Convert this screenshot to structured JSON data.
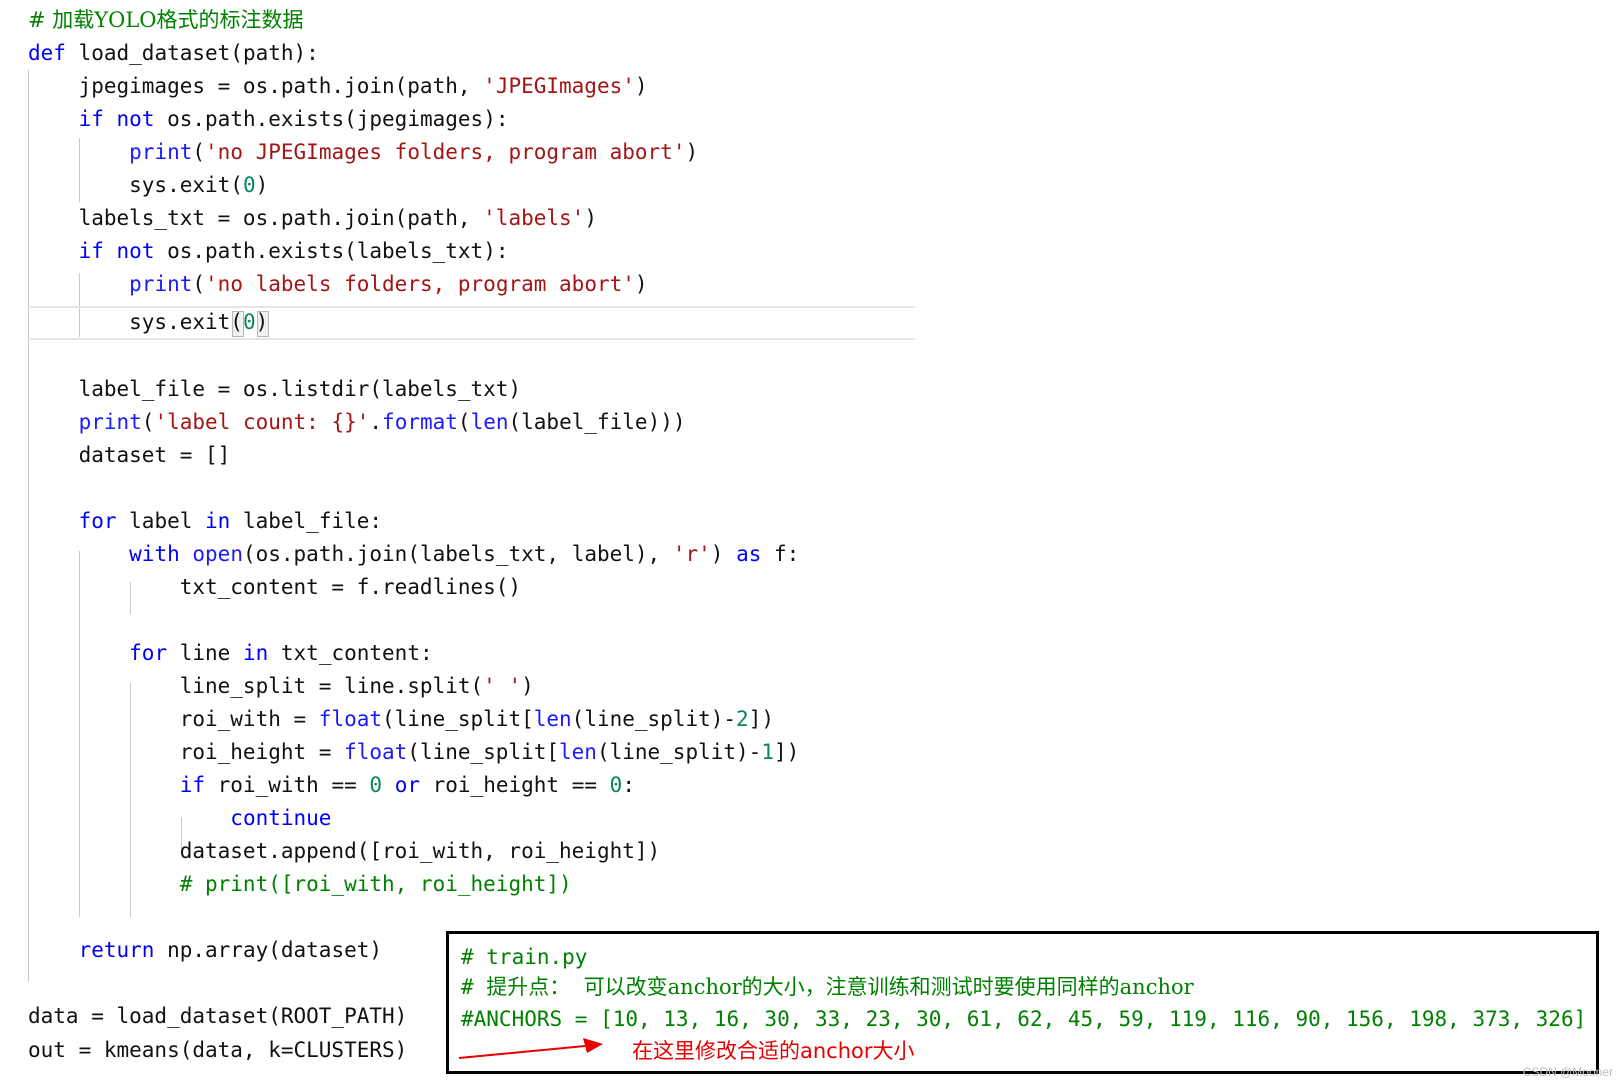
{
  "code": {
    "l1_comment": "# 加载YOLO格式的标注数据",
    "l2": {
      "kw": "def",
      "rest": " load_dataset(path):"
    },
    "l3": {
      "a": "    jpegimages = os.path.join(path, ",
      "s": "'JPEGImages'",
      "b": ")"
    },
    "l4": {
      "i": "    ",
      "kw1": "if",
      "sp": " ",
      "kw2": "not",
      "rest": " os.path.exists(jpegimages):"
    },
    "l5": {
      "i": "        ",
      "fn": "print",
      "p": "(",
      "s": "'no JPEGImages folders, program abort'",
      "b": ")"
    },
    "l6": {
      "a": "        sys.exit(",
      "n": "0",
      "b": ")"
    },
    "l7": {
      "a": "    labels_txt = os.path.join(path, ",
      "s": "'labels'",
      "b": ")"
    },
    "l8": {
      "i": "    ",
      "kw1": "if",
      "sp": " ",
      "kw2": "not",
      "rest": " os.path.exists(labels_txt):"
    },
    "l9": {
      "i": "        ",
      "fn": "print",
      "p": "(",
      "s": "'no labels folders, program abort'",
      "b": ")"
    },
    "l10": {
      "a": "        sys.exit(",
      "n": "0",
      "b": ")"
    },
    "l11": "    label_file = os.listdir(labels_txt)",
    "l12": {
      "i": "    ",
      "fn": "print",
      "p": "(",
      "s": "'label count: {}'",
      "dot": ".",
      "fn2": "format",
      "p2": "(",
      "fn3": "len",
      "b": "(label_file)))"
    },
    "l13": "    dataset = []",
    "l14": {
      "i": "    ",
      "kw1": "for",
      "mid": " label ",
      "kw2": "in",
      "rest": " label_file:"
    },
    "l15": {
      "i": "        ",
      "kw1": "with",
      "sp": " ",
      "fn": "open",
      "mid": "(os.path.join(labels_txt, label), ",
      "s": "'r'",
      "b": ") ",
      "kw2": "as",
      "rest": " f:"
    },
    "l16": "            txt_content = f.readlines()",
    "l17": {
      "i": "        ",
      "kw1": "for",
      "mid": " line ",
      "kw2": "in",
      "rest": " txt_content:"
    },
    "l18": {
      "a": "            line_split = line.split(",
      "s": "' '",
      "b": ")"
    },
    "l19": {
      "a": "            roi_with = ",
      "fn": "float",
      "m": "(line_split[",
      "fn2": "len",
      "m2": "(line_split)-",
      "n": "2",
      "b": "])"
    },
    "l20": {
      "a": "            roi_height = ",
      "fn": "float",
      "m": "(line_split[",
      "fn2": "len",
      "m2": "(line_split)-",
      "n": "1",
      "b": "])"
    },
    "l21": {
      "i": "            ",
      "kw1": "if",
      "a": " roi_with == ",
      "n1": "0",
      "sp": " ",
      "kw2": "or",
      "b": " roi_height == ",
      "n2": "0",
      "c": ":"
    },
    "l22": {
      "i": "                ",
      "kw": "continue"
    },
    "l23": "            dataset.append([roi_with, roi_height])",
    "l24": {
      "i": "            ",
      "c": "# print([roi_with, roi_height])"
    },
    "l25": {
      "i": "    ",
      "kw": "return",
      "rest": " np.array(dataset)"
    },
    "l26": "data = load_dataset(ROOT_PATH)",
    "l27": "out = kmeans(data, k=CLUSTERS)"
  },
  "callout": {
    "line1": "# train.py",
    "line2_hash": "# ",
    "line2_text": "提升点：  可以改变anchor的大小，注意训练和测试时要使用同样的anchor",
    "line3": "#ANCHORS = [10, 13, 16, 30, 33, 23, 30, 61, 62, 45, 59, 119, 116, 90, 156, 198, 373, 326]",
    "note": "在这里修改合适的anchor大小"
  },
  "watermark": "CSDN @Mooner",
  "colors": {
    "keyword": "#0000ff",
    "string": "#a31515",
    "number": "#098658",
    "comment": "#008000",
    "annotation": "#e60000"
  }
}
